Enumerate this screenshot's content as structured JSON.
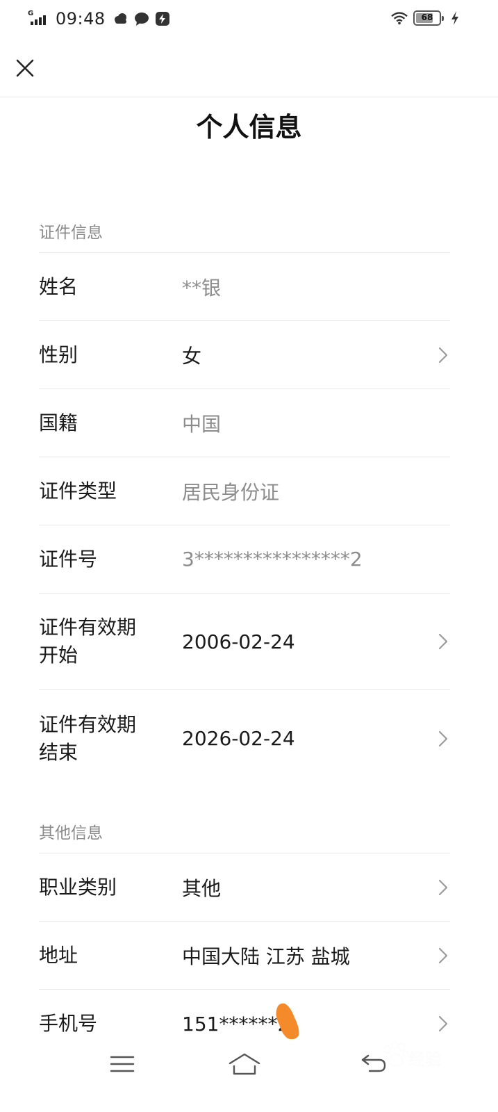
{
  "status_bar": {
    "network": "G",
    "time": "09:48",
    "battery": "68"
  },
  "page_title": "个人信息",
  "sections": [
    {
      "label": "证件信息",
      "rows": [
        {
          "label": "姓名",
          "value": "**银"
        },
        {
          "label": "性别",
          "value": "女"
        },
        {
          "label": "国籍",
          "value": "中国"
        },
        {
          "label": "证件类型",
          "value": "居民身份证"
        },
        {
          "label": "证件号",
          "value": "3****************2"
        },
        {
          "label": "证件有效期\n开始",
          "value": "2006-02-24"
        },
        {
          "label": "证件有效期\n结束",
          "value": "2026-02-24"
        }
      ]
    },
    {
      "label": "其他信息",
      "rows": [
        {
          "label": "职业类别",
          "value": "其他"
        },
        {
          "label": "地址",
          "value": "中国大陆 江苏 盐城"
        },
        {
          "label": "手机号",
          "value": "151******2"
        }
      ]
    }
  ],
  "watermark": {
    "text": "经验"
  },
  "icons": {
    "close": "close-icon",
    "chevron": "chevron-right-icon",
    "menu": "menu-icon",
    "home": "home-icon",
    "back": "back-icon"
  }
}
